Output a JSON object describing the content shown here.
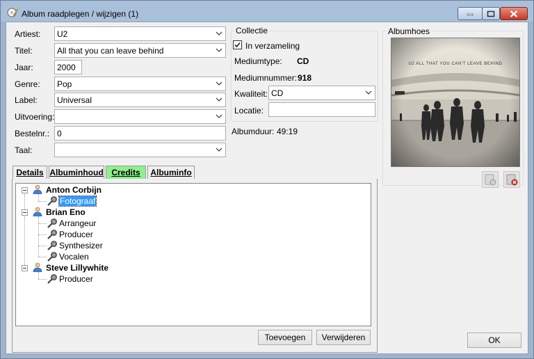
{
  "window": {
    "title": "Album raadplegen / wijzigen (1)"
  },
  "form": {
    "artist": {
      "label": "Artiest:",
      "value": "U2"
    },
    "title": {
      "label": "Titel:",
      "value": "All that you can leave behind"
    },
    "year": {
      "label": "Jaar:",
      "value": "2000"
    },
    "genre": {
      "label": "Genre:",
      "value": "Pop"
    },
    "record_label": {
      "label": "Label:",
      "value": "Universal"
    },
    "edition": {
      "label": "Uitvoering:",
      "value": ""
    },
    "order_number": {
      "label": "Bestelnr.:",
      "value": "0"
    },
    "language": {
      "label": "Taal:",
      "value": ""
    }
  },
  "collection": {
    "group_title": "Collectie",
    "in_collection_label": "In verzameling",
    "in_collection_checked": true,
    "media_type_label": "Mediumtype:",
    "media_type_value": "CD",
    "media_number_label": "Mediumnummer:",
    "media_number_value": "918",
    "quality_label": "Kwaliteit:",
    "quality_value": "CD",
    "location_label": "Locatie:",
    "location_value": ""
  },
  "album_duration": {
    "label": "Albumduur:",
    "value": "49:19"
  },
  "cover": {
    "group_title": "Albumhoes",
    "cover_text": "U2 ALL THAT YOU CAN'T LEAVE BEHIND"
  },
  "tabs": [
    {
      "label": "Details",
      "active": false
    },
    {
      "label": "Albuminhoud",
      "active": false
    },
    {
      "label": "Credits",
      "active": true
    },
    {
      "label": "Albuminfo",
      "active": false
    }
  ],
  "credits": [
    {
      "name": "Anton Corbijn",
      "roles": [
        "Fotograaf"
      ]
    },
    {
      "name": "Brian Eno",
      "roles": [
        "Arrangeur",
        "Producer",
        "Synthesizer",
        "Vocalen"
      ]
    },
    {
      "name": "Steve Lillywhite",
      "roles": [
        "Producer"
      ]
    }
  ],
  "selected_role": "Fotograaf",
  "buttons": {
    "add": "Toevoegen",
    "remove": "Verwijderen",
    "ok": "OK"
  },
  "colors": {
    "active_tab": "#8fef8f",
    "selection": "#3399ff",
    "titlebar": "#a9c0da"
  }
}
